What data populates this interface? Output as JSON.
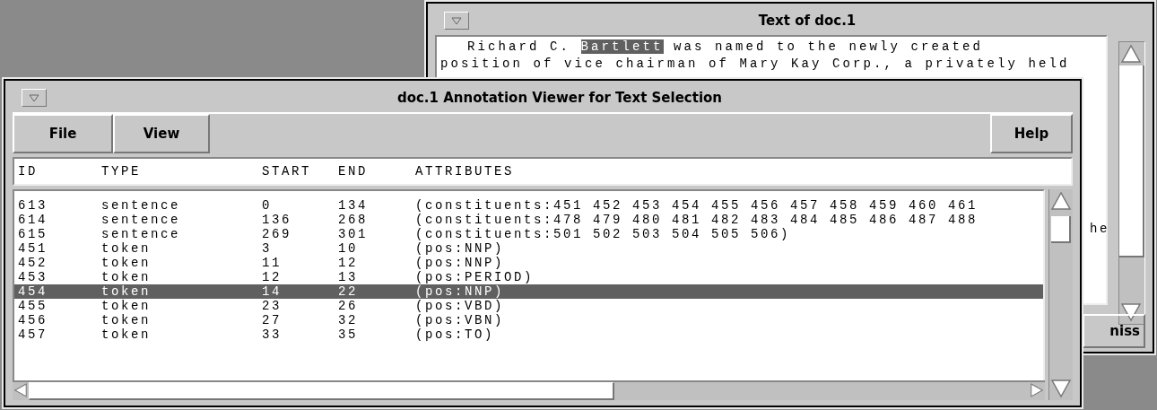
{
  "text_window": {
    "title": "Text of doc.1",
    "lines": [
      [
        {
          "text": "Richard C. ",
          "highlighted": false
        },
        {
          "text": "Bartlett",
          "highlighted": true
        },
        {
          "text": " was named to the newly created",
          "highlighted": false
        }
      ],
      [
        {
          "text": "position of vice chairman of Mary Kay Corp., a privately held",
          "highlighted": false
        }
      ]
    ],
    "line_fragment": "he",
    "button_fragment": "niss"
  },
  "annotation_window": {
    "title": "doc.1 Annotation Viewer for Text Selection",
    "menus": [
      "File",
      "View"
    ],
    "help_menu": "Help",
    "columns": [
      "ID",
      "TYPE",
      "START",
      "END",
      "ATTRIBUTES"
    ],
    "rows": [
      {
        "cells": [
          "613",
          "sentence",
          "0",
          "134",
          "(constituents:451 452 453 454 455 456 457 458 459 460 461"
        ],
        "selected": false
      },
      {
        "cells": [
          "614",
          "sentence",
          "136",
          "268",
          "(constituents:478 479 480 481 482 483 484 485 486 487 488"
        ],
        "selected": false
      },
      {
        "cells": [
          "615",
          "sentence",
          "269",
          "301",
          "(constituents:501 502 503 504 505 506)"
        ],
        "selected": false
      },
      {
        "cells": [
          "451",
          "token",
          "3",
          "10",
          "(pos:NNP)"
        ],
        "selected": false
      },
      {
        "cells": [
          "452",
          "token",
          "11",
          "12",
          "(pos:NNP)"
        ],
        "selected": false
      },
      {
        "cells": [
          "453",
          "token",
          "12",
          "13",
          "(pos:PERIOD)"
        ],
        "selected": false
      },
      {
        "cells": [
          "454",
          "token",
          "14",
          "22",
          "(pos:NNP)"
        ],
        "selected": true
      },
      {
        "cells": [
          "455",
          "token",
          "23",
          "26",
          "(pos:VBD)"
        ],
        "selected": false
      },
      {
        "cells": [
          "456",
          "token",
          "27",
          "32",
          "(pos:VBN)"
        ],
        "selected": false
      },
      {
        "cells": [
          "457",
          "token",
          "33",
          "35",
          "(pos:TO)"
        ],
        "selected": false
      }
    ]
  }
}
